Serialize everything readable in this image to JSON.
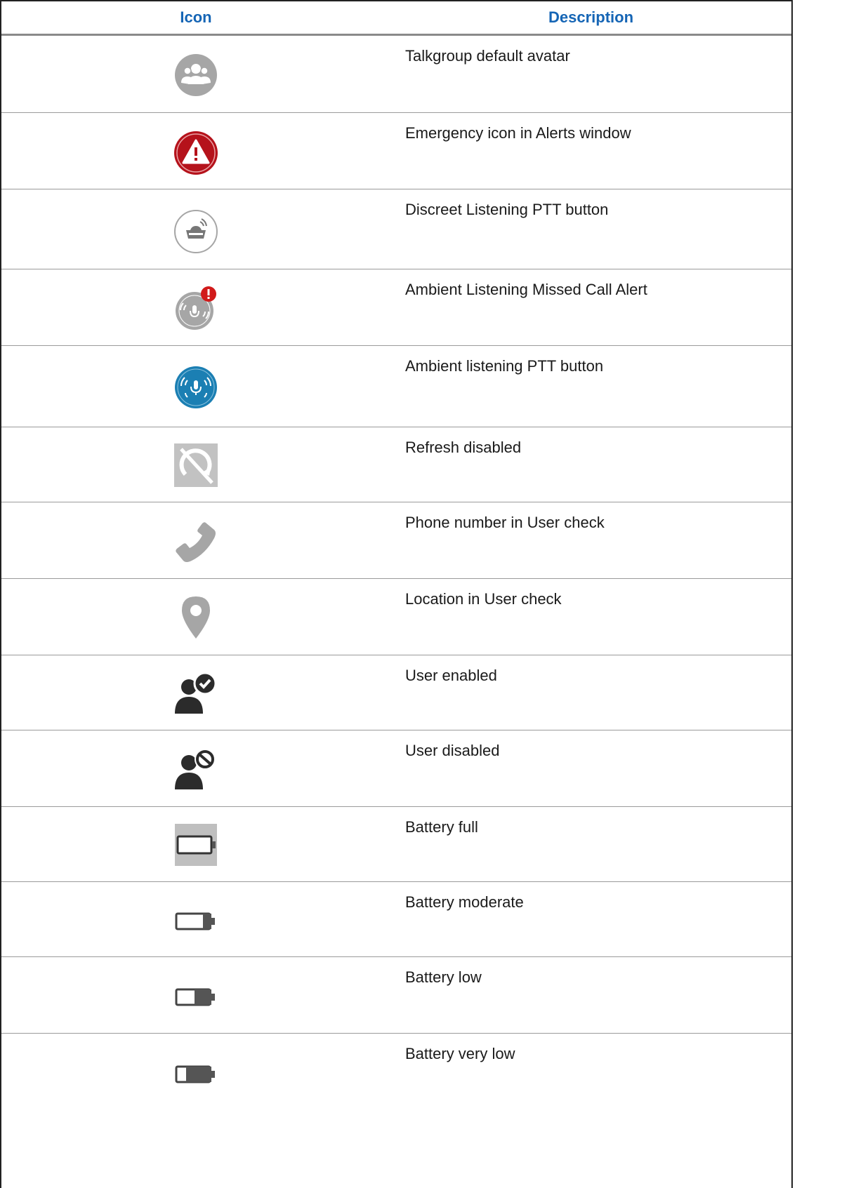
{
  "header": {
    "col_icon": "Icon",
    "col_description": "Description"
  },
  "rows": [
    {
      "icon": "talkgroup-avatar-icon",
      "description": "Talkgroup default avatar"
    },
    {
      "icon": "emergency-alert-icon",
      "description": "Emergency icon in Alerts window"
    },
    {
      "icon": "discreet-listening-ptt-icon",
      "description": "Discreet Listening PTT button"
    },
    {
      "icon": "ambient-missed-call-alert-icon",
      "description": "Ambient Listening Missed Call Alert"
    },
    {
      "icon": "ambient-listening-ptt-icon",
      "description": "Ambient listening PTT button"
    },
    {
      "icon": "refresh-disabled-icon",
      "description": "Refresh disabled"
    },
    {
      "icon": "phone-icon",
      "description": "Phone number in User check"
    },
    {
      "icon": "location-pin-icon",
      "description": "Location in User check"
    },
    {
      "icon": "user-enabled-icon",
      "description": "User enabled"
    },
    {
      "icon": "user-disabled-icon",
      "description": "User disabled"
    },
    {
      "icon": "battery-full-icon",
      "description": "Battery full"
    },
    {
      "icon": "battery-moderate-icon",
      "description": "Battery moderate"
    },
    {
      "icon": "battery-low-icon",
      "description": "Battery low"
    },
    {
      "icon": "battery-very-low-icon",
      "description": "Battery very low"
    }
  ],
  "colors": {
    "header_text": "#1565b5",
    "emergency": "#b5121b",
    "ambient_blue": "#1b7fb3",
    "icon_gray": "#a6a6a6",
    "user_dark": "#2b2b2b"
  }
}
